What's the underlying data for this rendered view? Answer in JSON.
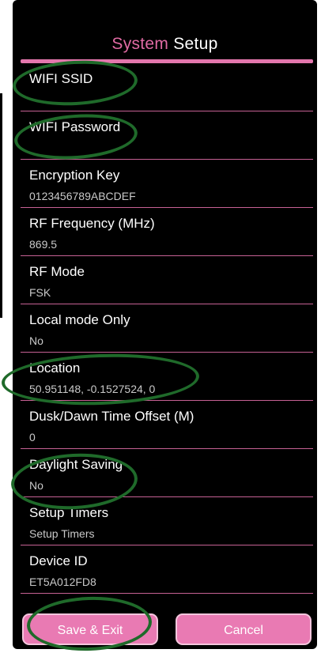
{
  "header": {
    "title_word1": "System",
    "title_word2": "Setup"
  },
  "settings": [
    {
      "label": "WIFI SSID",
      "value": ""
    },
    {
      "label": "WIFI Password",
      "value": ""
    },
    {
      "label": "Encryption Key",
      "value": "0123456789ABCDEF"
    },
    {
      "label": "RF Frequency (MHz)",
      "value": "869.5"
    },
    {
      "label": "RF Mode",
      "value": "FSK"
    },
    {
      "label": "Local mode Only",
      "value": "No"
    },
    {
      "label": "Location",
      "value": "50.951148, -0.1527524, 0"
    },
    {
      "label": "Dusk/Dawn Time Offset (M)",
      "value": "0"
    },
    {
      "label": "Daylight Saving",
      "value": "No"
    },
    {
      "label": "Setup Timers",
      "value": "Setup Timers"
    },
    {
      "label": "Device ID",
      "value": "ET5A012FD8"
    }
  ],
  "footer": {
    "save_label": "Save & Exit",
    "cancel_label": "Cancel"
  },
  "colors": {
    "accent_pink": "#e377ad",
    "annotation_green": "#1f6a2a",
    "background": "#000000"
  }
}
